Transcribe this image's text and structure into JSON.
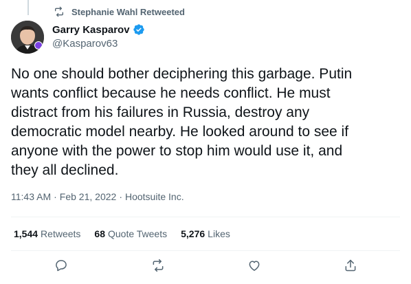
{
  "retweet_context": {
    "text": "Stephanie Wahl Retweeted",
    "icon": "retweet-icon"
  },
  "author": {
    "name": "Garry Kasparov",
    "handle": "@Kasparov63",
    "verified_color": "#1d9bf0"
  },
  "tweet": {
    "text": "No one should bother deciphering this garbage. Putin\nwants conflict because he needs conflict. He must\ndistract from his failures in Russia, destroy any\ndemocratic model nearby. He looked around to see if\nanyone with the power to stop him would use it, and\nthey all declined.",
    "time": "11:43 AM",
    "date": "Feb 21, 2022",
    "source": "Hootsuite Inc.",
    "separator": "·"
  },
  "stats": {
    "retweets": {
      "count": "1,544",
      "label": "Retweets"
    },
    "quote_tweets": {
      "count": "68",
      "label": "Quote Tweets"
    },
    "likes": {
      "count": "5,276",
      "label": "Likes"
    }
  },
  "actions": [
    "reply-icon",
    "retweet-icon",
    "like-icon",
    "share-icon"
  ],
  "colors": {
    "text": "#0f1419",
    "secondary": "#536471",
    "divider": "#eff3f4"
  }
}
